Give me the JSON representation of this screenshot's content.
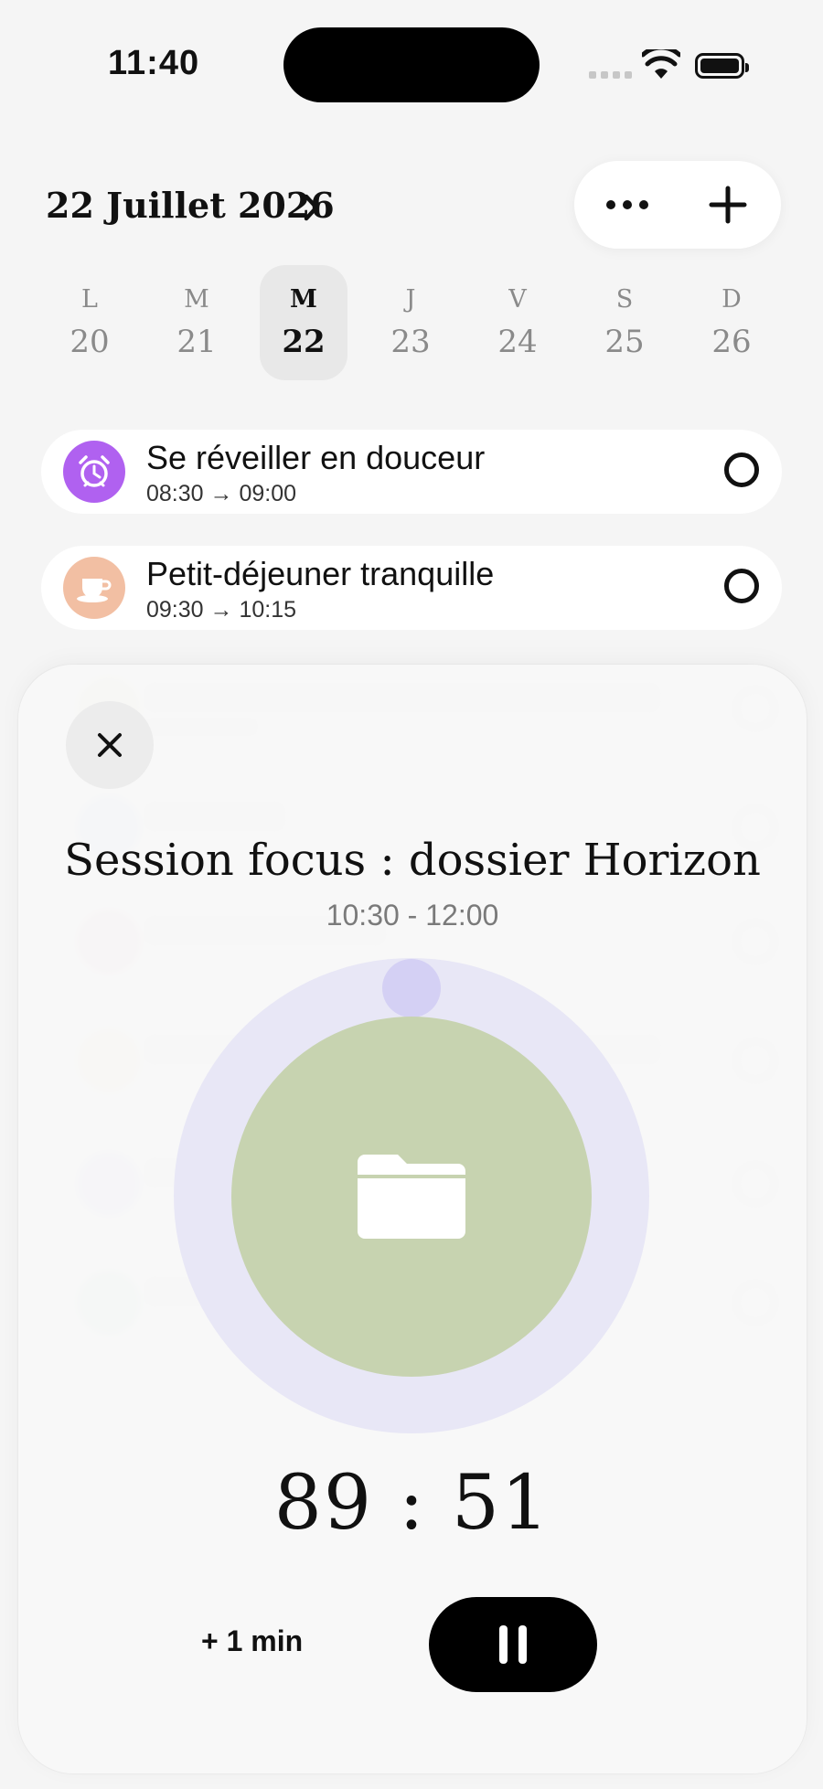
{
  "status_bar": {
    "time": "11:40"
  },
  "header": {
    "date_title": "22 Juillet 2026"
  },
  "week": [
    {
      "letter": "L",
      "number": "20",
      "selected": false
    },
    {
      "letter": "M",
      "number": "21",
      "selected": false
    },
    {
      "letter": "M",
      "number": "22",
      "selected": true
    },
    {
      "letter": "J",
      "number": "23",
      "selected": false
    },
    {
      "letter": "V",
      "number": "24",
      "selected": false
    },
    {
      "letter": "S",
      "number": "25",
      "selected": false
    },
    {
      "letter": "D",
      "number": "26",
      "selected": false
    }
  ],
  "tasks": [
    {
      "title": "Se réveiller en douceur",
      "time": "08:30 → 09:00",
      "icon": "alarm-clock-icon",
      "color": "#b061f0"
    },
    {
      "title": "Petit-déjeuner tranquille",
      "time": "09:30 → 10:15",
      "icon": "coffee-cup-icon",
      "color": "#f2bfa3"
    }
  ],
  "focus_sheet": {
    "title": "Session focus : dossier Horizon",
    "time_range": "10:30 - 12:00",
    "remaining": "89 : 51",
    "add_time_label": "+ 1 min",
    "ring_color": "#d5d2f5",
    "inner_color": "#c7d3b0",
    "icon": "folder-icon"
  }
}
